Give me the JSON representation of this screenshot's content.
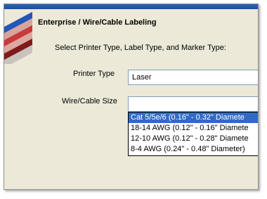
{
  "header": {
    "title": "Enterprise / Wire/Cable Labeling"
  },
  "instruction": "Select Printer Type, Label Type, and Marker Type:",
  "printer_type": {
    "label": "Printer Type",
    "value": "Laser"
  },
  "wire_size": {
    "label": "Wire/Cable Size",
    "value": "",
    "options": [
      "Cat 5/5e/6  (0.16\" - 0.32\" Diamete",
      "18-14 AWG  (0.12\" - 0.16\" Diamete",
      "12-10 AWG  (0.12\" - 0.28\" Diamete",
      "8-4 AWG  (0.24\" - 0.48\" Diameter)"
    ],
    "selected_index": 0
  },
  "colors": {
    "highlight": "#316ac5",
    "panel": "#ece9d8",
    "titlebar": "#1b4e9f"
  }
}
